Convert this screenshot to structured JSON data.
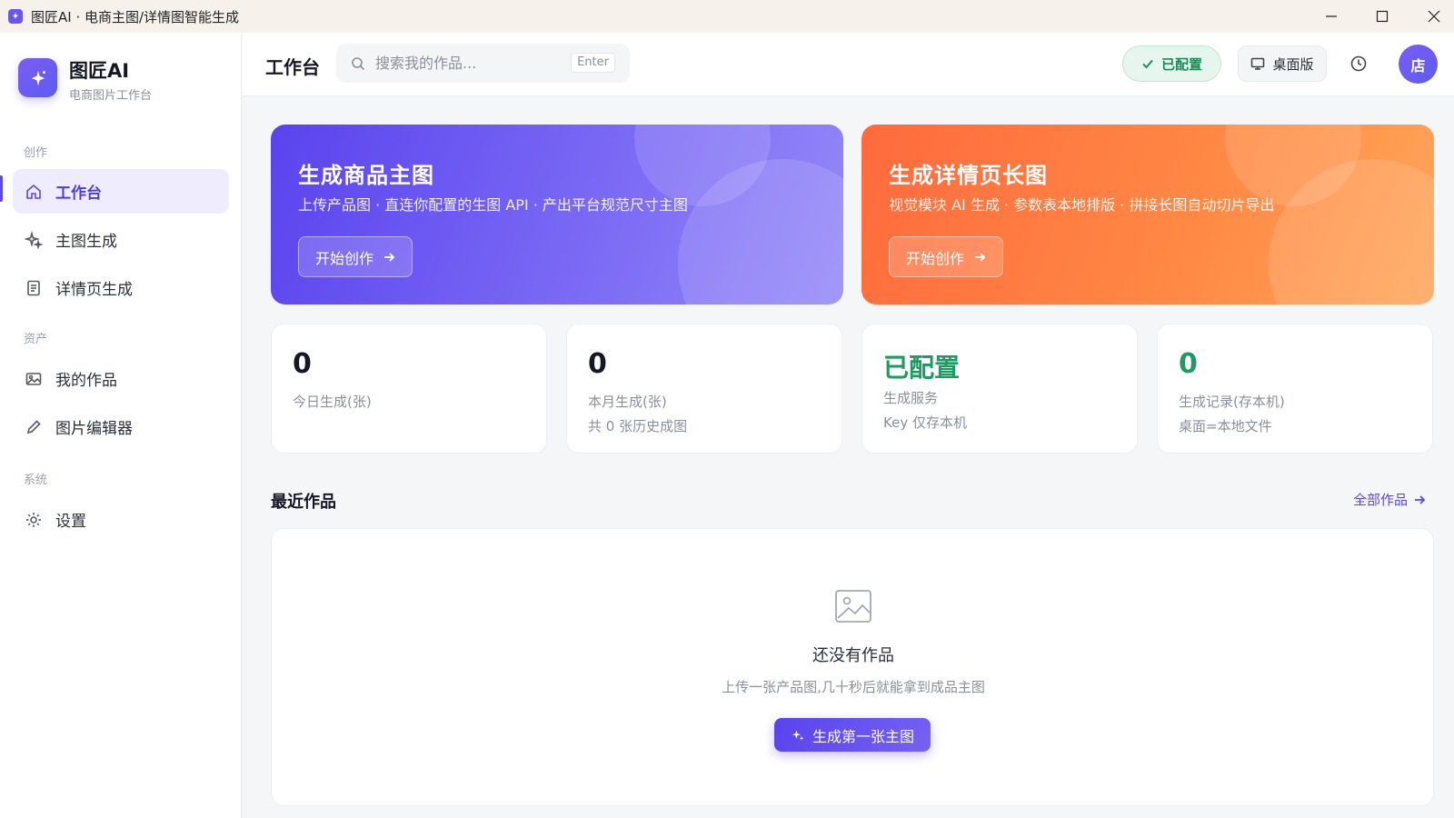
{
  "window": {
    "title": "图匠AI · 电商主图/详情图智能生成"
  },
  "sidebar": {
    "brand_name": "图匠AI",
    "brand_sub": "电商图片工作台",
    "sections": {
      "create": "创作",
      "assets": "资产",
      "system": "系统"
    },
    "items": [
      {
        "label": "工作台",
        "icon": "home-icon",
        "active": true
      },
      {
        "label": "主图生成",
        "icon": "sparkle-icon",
        "active": false
      },
      {
        "label": "详情页生成",
        "icon": "document-icon",
        "active": false
      },
      {
        "label": "我的作品",
        "icon": "image-icon",
        "active": false
      },
      {
        "label": "图片编辑器",
        "icon": "pencil-icon",
        "active": false
      },
      {
        "label": "设置",
        "icon": "gear-icon",
        "active": false
      }
    ]
  },
  "header": {
    "title": "工作台",
    "search_placeholder": "搜索我的作品...",
    "search_shortcut": "Enter",
    "configured_label": "已配置",
    "desktop_label": "桌面版",
    "avatar_text": "店"
  },
  "hero": {
    "main": {
      "title": "生成商品主图",
      "desc": "上传产品图 · 直连你配置的生图 API · 产出平台规范尺寸主图",
      "button": "开始创作"
    },
    "detail": {
      "title": "生成详情页长图",
      "desc": "视觉模块 AI 生成 · 参数表本地排版 · 拼接长图自动切片导出",
      "button": "开始创作"
    }
  },
  "stats": [
    {
      "value": "0",
      "line1": "今日生成(张)",
      "line2": ""
    },
    {
      "value": "0",
      "line1": "本月生成(张)",
      "line2": "共 0 张历史成图"
    },
    {
      "value": "已配置",
      "line1": "生成服务",
      "line2": "Key 仅存本机"
    },
    {
      "value": "0",
      "line1": "生成记录(存本机)",
      "line2": "桌面=本地文件"
    }
  ],
  "recent": {
    "title": "最近作品",
    "all_link": "全部作品",
    "empty_title": "还没有作品",
    "empty_sub": "上传一张产品图,几十秒后就能拿到成品主图",
    "cta": "生成第一张主图"
  },
  "colors": {
    "accent": "#5b48e8",
    "success": "#1e9a63",
    "hero_orange": "#ff7a42"
  }
}
